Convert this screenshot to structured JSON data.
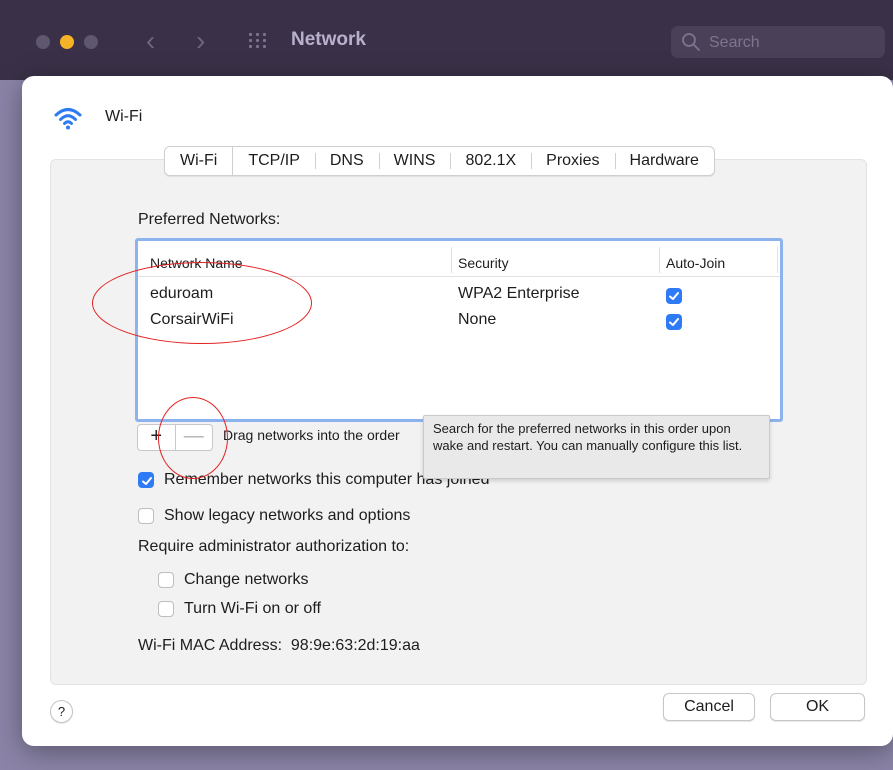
{
  "window": {
    "title": "Network",
    "search_placeholder": "Search",
    "traffic_light_colors": {
      "minimize": "#f5b427",
      "inactive": "#5f5670"
    }
  },
  "sheet": {
    "title": "Wi-Fi",
    "icon": "wifi-icon",
    "tabs": [
      {
        "label": "Wi-Fi",
        "active": true
      },
      {
        "label": "TCP/IP"
      },
      {
        "label": "DNS"
      },
      {
        "label": "WINS"
      },
      {
        "label": "802.1X"
      },
      {
        "label": "Proxies"
      },
      {
        "label": "Hardware"
      }
    ]
  },
  "preferred": {
    "label": "Preferred Networks:",
    "columns": [
      "Network Name",
      "Security",
      "Auto-Join"
    ],
    "rows": [
      {
        "name": "eduroam",
        "security": "WPA2 Enterprise",
        "auto_join": true
      },
      {
        "name": "CorsairWiFi",
        "security": "None",
        "auto_join": true
      }
    ],
    "add_label": "+",
    "remove_label": "—",
    "drag_hint": "Drag networks into the order",
    "tooltip": "Search for the preferred networks in this order upon wake and restart. You can manually configure this list."
  },
  "options": {
    "remember": {
      "label": "Remember networks this computer has joined",
      "checked": true
    },
    "legacy": {
      "label": "Show legacy networks and options",
      "checked": false
    },
    "admin_label": "Require administrator authorization to:",
    "change_networks": {
      "label": "Change networks",
      "checked": false
    },
    "toggle_wifi": {
      "label": "Turn Wi-Fi on or off",
      "checked": false
    }
  },
  "mac": {
    "label": "Wi-Fi MAC Address:",
    "value": "98:9e:63:2d:19:aa"
  },
  "footer": {
    "help": "?",
    "cancel": "Cancel",
    "ok": "OK"
  },
  "colors": {
    "accent": "#2f7bf5",
    "annotation": "#e32222"
  }
}
